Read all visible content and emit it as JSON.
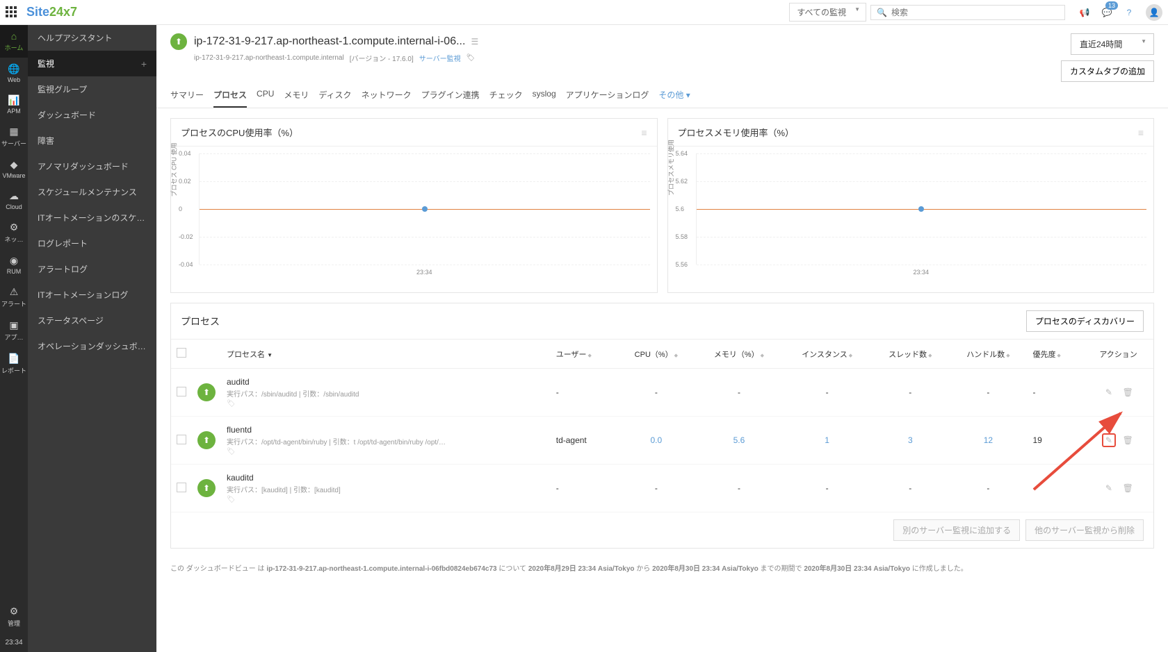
{
  "top": {
    "monitor_select": "すべての監視",
    "search_placeholder": "検索",
    "badge": "13"
  },
  "logo": {
    "a": "Site",
    "b": "24x7"
  },
  "rail": [
    {
      "label": "ホーム",
      "active": true
    },
    {
      "label": "Web"
    },
    {
      "label": "APM"
    },
    {
      "label": "サーバー"
    },
    {
      "label": "VMware"
    },
    {
      "label": "Cloud"
    },
    {
      "label": "ネッ…"
    },
    {
      "label": "RUM"
    },
    {
      "label": "アラート"
    },
    {
      "label": "アプ…"
    },
    {
      "label": "レポート"
    }
  ],
  "rail_bottom": {
    "label": "管理"
  },
  "rail_time": "23:34",
  "sidebar": [
    {
      "label": "ヘルプアシスタント"
    },
    {
      "label": "監視",
      "active": true,
      "plus": true
    },
    {
      "label": "監視グループ"
    },
    {
      "label": "ダッシュボード"
    },
    {
      "label": "障害"
    },
    {
      "label": "アノマリダッシュボード"
    },
    {
      "label": "スケジュールメンテナンス"
    },
    {
      "label": "ITオートメーションのスケ…"
    },
    {
      "label": "ログレポート"
    },
    {
      "label": "アラートログ"
    },
    {
      "label": "ITオートメーションログ"
    },
    {
      "label": "ステータスページ"
    },
    {
      "label": "オペレーションダッシュボ…"
    }
  ],
  "header": {
    "title": "ip-172-31-9-217.ap-northeast-1.compute.internal-i-06...",
    "host": "ip-172-31-9-217.ap-northeast-1.compute.internal",
    "version": "[バージョン - 17.6.0]",
    "type_link": "サーバー監視",
    "period": "直近24時間",
    "custom_tab_btn": "カスタムタブの追加"
  },
  "tabs": [
    {
      "label": "サマリー"
    },
    {
      "label": "プロセス",
      "active": true
    },
    {
      "label": "CPU"
    },
    {
      "label": "メモリ"
    },
    {
      "label": "ディスク"
    },
    {
      "label": "ネットワーク"
    },
    {
      "label": "プラグイン連携"
    },
    {
      "label": "チェック"
    },
    {
      "label": "syslog"
    },
    {
      "label": "アプリケーションログ"
    },
    {
      "label": "その他 ▾",
      "more": true
    }
  ],
  "chart1": {
    "title": "プロセスのCPU使用率（%）",
    "ylabel": "プロセス CPU 使用",
    "yticks": [
      "0.04",
      "0.02",
      "0",
      "-0.02",
      "-0.04"
    ],
    "xtick": "23:34"
  },
  "chart2": {
    "title": "プロセスメモリ使用率（%）",
    "ylabel": "プロセスメモリ使用",
    "yticks": [
      "5.64",
      "5.62",
      "5.6",
      "5.58",
      "5.56"
    ],
    "xtick": "23:34"
  },
  "chart_data": [
    {
      "type": "line",
      "title": "プロセスのCPU使用率（%）",
      "ylabel": "プロセス CPU 使用",
      "ylim": [
        -0.04,
        0.04
      ],
      "x": [
        "23:34"
      ],
      "series": [
        {
          "name": "CPU",
          "values": [
            0
          ]
        }
      ]
    },
    {
      "type": "line",
      "title": "プロセスメモリ使用率（%）",
      "ylabel": "プロセスメモリ使用",
      "ylim": [
        5.56,
        5.64
      ],
      "x": [
        "23:34"
      ],
      "series": [
        {
          "name": "Memory",
          "values": [
            5.6
          ]
        }
      ]
    }
  ],
  "table": {
    "title": "プロセス",
    "discovery_btn": "プロセスのディスカバリー",
    "cols": {
      "name": "プロセス名",
      "user": "ユーザー",
      "cpu": "CPU（%）",
      "mem": "メモリ（%）",
      "inst": "インスタンス",
      "threads": "スレッド数",
      "handles": "ハンドル数",
      "prio": "優先度",
      "actions": "アクション"
    },
    "rows": [
      {
        "name": "auditd",
        "sub": "実行パス：/sbin/auditd | 引数：/sbin/auditd",
        "user": "-",
        "cpu": "-",
        "mem": "-",
        "inst": "-",
        "threads": "-",
        "handles": "-",
        "prio": "-",
        "highlight": false
      },
      {
        "name": "fluentd",
        "sub": "実行パス：/opt/td-agent/bin/ruby | 引数：t /opt/td-agent/bin/ruby /opt/…",
        "user": "td-agent",
        "cpu": "0.0",
        "mem": "5.6",
        "inst": "1",
        "threads": "3",
        "handles": "12",
        "prio": "19",
        "highlight": true
      },
      {
        "name": "kauditd",
        "sub": "実行パス：[kauditd] | 引数：[kauditd]",
        "user": "-",
        "cpu": "-",
        "mem": "-",
        "inst": "-",
        "threads": "-",
        "handles": "-",
        "prio": "-",
        "highlight": false
      }
    ],
    "footer": {
      "add_btn": "別のサーバー監視に追加する",
      "del_btn": "他のサーバー監視から削除"
    }
  },
  "ts": {
    "a": "この ダッシュボードビュー は ",
    "b": "ip-172-31-9-217.ap-northeast-1.compute.internal-i-06fbd0824eb674c73",
    "c": " について ",
    "d": "2020年8月29日 23:34 Asia/Tokyo",
    "e": " から ",
    "f": "2020年8月30日 23:34 Asia/Tokyo",
    "g": " までの期間で ",
    "h": "2020年8月30日 23:34 Asia/Tokyo",
    "i": " に作成しました。"
  }
}
